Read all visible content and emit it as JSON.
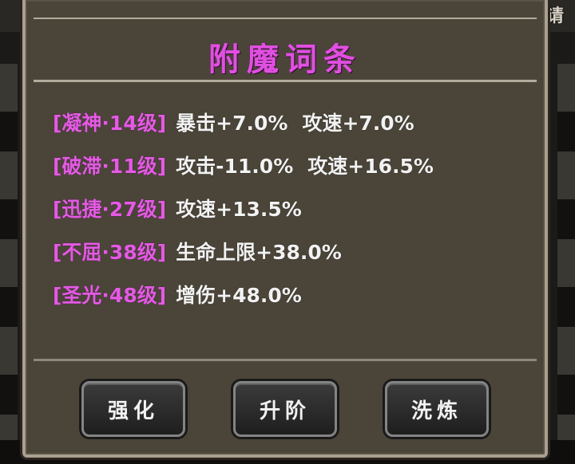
{
  "header": {
    "corner_glyph": "请"
  },
  "panel": {
    "title": "附魔词条",
    "affixes": [
      {
        "name": "[凝神·14级]",
        "effects": [
          "暴击+7.0%",
          "攻速+7.0%"
        ]
      },
      {
        "name": "[破滞·11级]",
        "effects": [
          "攻击-11.0%",
          "攻速+16.5%"
        ]
      },
      {
        "name": "[迅捷·27级]",
        "effects": [
          "攻速+13.5%"
        ]
      },
      {
        "name": "[不屈·38级]",
        "effects": [
          "生命上限+38.0%"
        ]
      },
      {
        "name": "[圣光·48级]",
        "effects": [
          "增伤+48.0%"
        ]
      }
    ],
    "buttons": {
      "enhance": "强化",
      "upgrade": "升阶",
      "reroll": "洗炼"
    }
  },
  "colors": {
    "accent_magenta": "#e45ae4",
    "panel_bg": "#4b4539",
    "text_white": "#f2f2f2"
  }
}
